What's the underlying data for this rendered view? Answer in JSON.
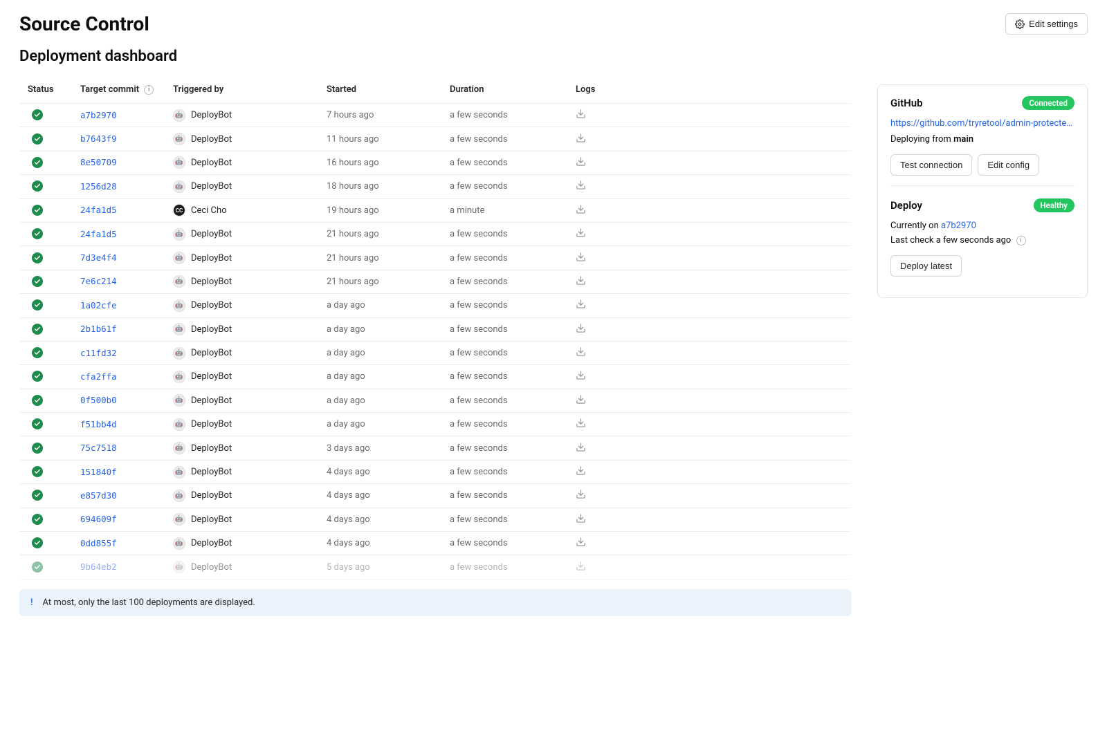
{
  "header": {
    "title": "Source Control",
    "edit_settings_label": "Edit settings"
  },
  "subtitle": "Deployment dashboard",
  "columns": {
    "status": "Status",
    "commit": "Target commit",
    "trigger": "Triggered by",
    "started": "Started",
    "duration": "Duration",
    "logs": "Logs"
  },
  "rows": [
    {
      "commit": "a7b2970",
      "trigger": "DeployBot",
      "avatar": "bot",
      "started": "7 hours ago",
      "duration": "a few seconds"
    },
    {
      "commit": "b7643f9",
      "trigger": "DeployBot",
      "avatar": "bot",
      "started": "11 hours ago",
      "duration": "a few seconds"
    },
    {
      "commit": "8e50709",
      "trigger": "DeployBot",
      "avatar": "bot",
      "started": "16 hours ago",
      "duration": "a few seconds"
    },
    {
      "commit": "1256d28",
      "trigger": "DeployBot",
      "avatar": "bot",
      "started": "18 hours ago",
      "duration": "a few seconds"
    },
    {
      "commit": "24fa1d5",
      "trigger": "Ceci Cho",
      "avatar": "user",
      "started": "19 hours ago",
      "duration": "a minute"
    },
    {
      "commit": "24fa1d5",
      "trigger": "DeployBot",
      "avatar": "bot",
      "started": "21 hours ago",
      "duration": "a few seconds"
    },
    {
      "commit": "7d3e4f4",
      "trigger": "DeployBot",
      "avatar": "bot",
      "started": "21 hours ago",
      "duration": "a few seconds"
    },
    {
      "commit": "7e6c214",
      "trigger": "DeployBot",
      "avatar": "bot",
      "started": "21 hours ago",
      "duration": "a few seconds"
    },
    {
      "commit": "1a02cfe",
      "trigger": "DeployBot",
      "avatar": "bot",
      "started": "a day ago",
      "duration": "a few seconds"
    },
    {
      "commit": "2b1b61f",
      "trigger": "DeployBot",
      "avatar": "bot",
      "started": "a day ago",
      "duration": "a few seconds"
    },
    {
      "commit": "c11fd32",
      "trigger": "DeployBot",
      "avatar": "bot",
      "started": "a day ago",
      "duration": "a few seconds"
    },
    {
      "commit": "cfa2ffa",
      "trigger": "DeployBot",
      "avatar": "bot",
      "started": "a day ago",
      "duration": "a few seconds"
    },
    {
      "commit": "0f500b0",
      "trigger": "DeployBot",
      "avatar": "bot",
      "started": "a day ago",
      "duration": "a few seconds"
    },
    {
      "commit": "f51bb4d",
      "trigger": "DeployBot",
      "avatar": "bot",
      "started": "a day ago",
      "duration": "a few seconds"
    },
    {
      "commit": "75c7518",
      "trigger": "DeployBot",
      "avatar": "bot",
      "started": "3 days ago",
      "duration": "a few seconds"
    },
    {
      "commit": "151840f",
      "trigger": "DeployBot",
      "avatar": "bot",
      "started": "4 days ago",
      "duration": "a few seconds"
    },
    {
      "commit": "e857d30",
      "trigger": "DeployBot",
      "avatar": "bot",
      "started": "4 days ago",
      "duration": "a few seconds"
    },
    {
      "commit": "694609f",
      "trigger": "DeployBot",
      "avatar": "bot",
      "started": "4 days ago",
      "duration": "a few seconds"
    },
    {
      "commit": "0dd855f",
      "trigger": "DeployBot",
      "avatar": "bot",
      "started": "4 days ago",
      "duration": "a few seconds"
    },
    {
      "commit": "9b64eb2",
      "trigger": "DeployBot",
      "avatar": "bot",
      "started": "5 days ago",
      "duration": "a few seconds"
    }
  ],
  "notice": "At most, only the last 100 deployments are displayed.",
  "sidebar": {
    "github": {
      "title": "GitHub",
      "status": "Connected",
      "url": "https://github.com/tryretool/admin-protected-...",
      "deploy_from_prefix": "Deploying from ",
      "deploy_from_branch": "main",
      "test_label": "Test connection",
      "edit_label": "Edit config"
    },
    "deploy": {
      "title": "Deploy",
      "status": "Healthy",
      "currently_prefix": "Currently on ",
      "currently_commit": "a7b2970",
      "last_check": "Last check a few seconds ago",
      "deploy_latest_label": "Deploy latest"
    }
  }
}
